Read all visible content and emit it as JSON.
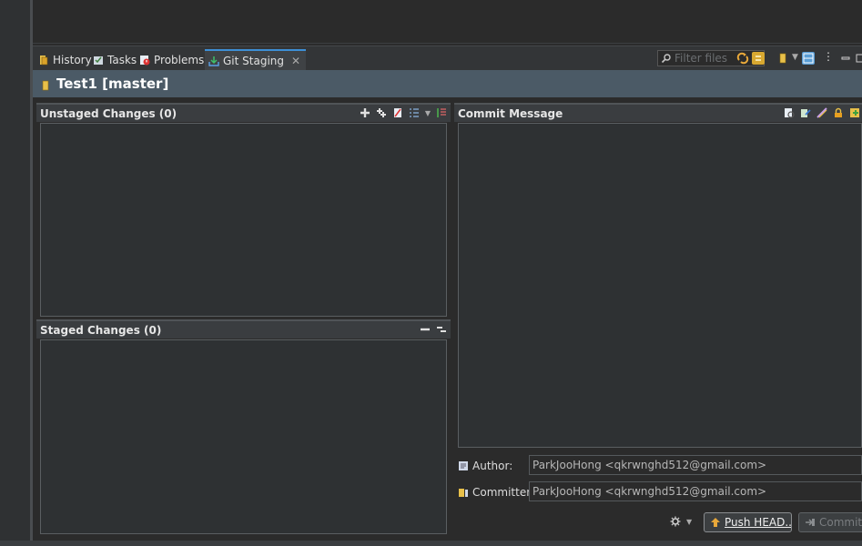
{
  "tabs": [
    {
      "label": "History",
      "icon": "history-icon"
    },
    {
      "label": "Tasks",
      "icon": "tasks-icon"
    },
    {
      "label": "Problems",
      "icon": "problems-icon"
    },
    {
      "label": "Git Staging",
      "icon": "git-staging-icon",
      "active": true
    }
  ],
  "toolbar": {
    "filter_placeholder": "Filter files"
  },
  "repo": {
    "title": "Test1 [master]"
  },
  "unstaged": {
    "title": "Unstaged Changes (0)"
  },
  "staged": {
    "title": "Staged Changes (0)"
  },
  "commit": {
    "title": "Commit Message",
    "message": "",
    "author_label": "Author:",
    "author_value": "ParkJooHong <qkrwnghd512@gmail.com>",
    "committer_label": "Committer:",
    "committer_value": "ParkJooHong <qkrwnghd512@gmail.com>",
    "push_label": "Push HEAD...",
    "commit_label": "Commit"
  },
  "colors": {
    "accent": "#3d8fd6",
    "repo_bar": "#4b5a66",
    "background": "#2b2b2b"
  }
}
